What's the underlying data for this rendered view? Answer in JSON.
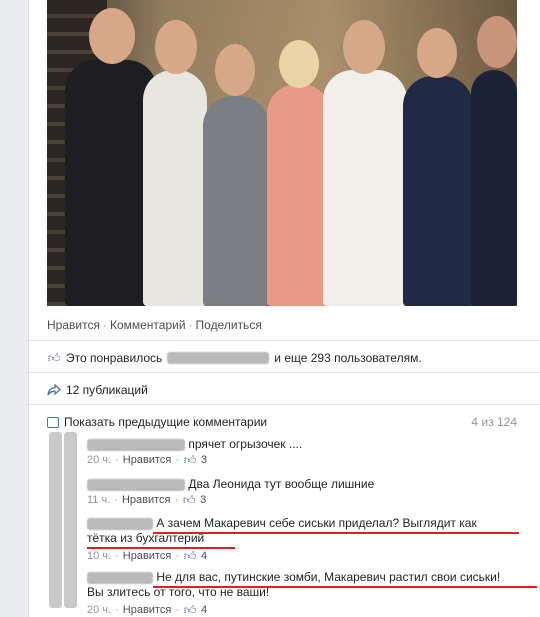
{
  "post": {
    "actions": {
      "like": "Нравится",
      "comment": "Комментарий",
      "share": "Поделиться"
    },
    "likes_prefix": "Это понравилось",
    "likes_suffix": "и еще 293 пользователям.",
    "shares": "12 публикаций",
    "prev_comments": "Показать предыдущие комментарии",
    "prev_count": "4 из 124"
  },
  "comments": [
    {
      "text": "прячет огрызочек ....",
      "time": "20 ч.",
      "like_label": "Нравится",
      "likes": "3"
    },
    {
      "text": "Два Леонида тут вообще лишние",
      "time": "11 ч.",
      "like_label": "Нравится",
      "likes": "3"
    },
    {
      "text_line1": "А зачем Макаревич себе сиськи приделал? Выглядит как",
      "text_line2": "тётка из бухгалтерий",
      "time": "10 ч.",
      "like_label": "Нравится",
      "likes": "4"
    },
    {
      "text_line1": "Не для вас, путинские зомби, Макаревич растил свои сиськи!",
      "text_line2": "Вы злитесь от того, что не ваши!",
      "time": "20 ч.",
      "like_label": "Нравится",
      "likes": "4"
    }
  ],
  "colors": {
    "link": "#4b6db3",
    "underline": "#e02020",
    "muted": "#90949c"
  }
}
